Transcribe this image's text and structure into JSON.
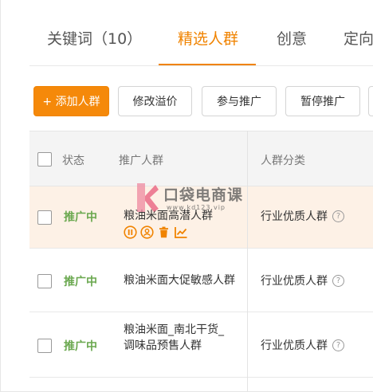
{
  "tabs": [
    {
      "label": "关键词（10）",
      "active": false
    },
    {
      "label": "精选人群",
      "active": true
    },
    {
      "label": "创意",
      "active": false
    },
    {
      "label": "定向",
      "active": false
    }
  ],
  "toolbar": {
    "add_label": "+ 添加人群",
    "modify_label": "修改溢价",
    "join_label": "参与推广",
    "pause_label": "暂停推广"
  },
  "table": {
    "headers": {
      "status": "状态",
      "crowd": "推广人群",
      "category": "人群分类"
    },
    "rows": [
      {
        "status": "推广中",
        "name_line1": "粮油米面高潜人群",
        "name_line2": "",
        "category": "行业优质人群"
      },
      {
        "status": "推广中",
        "name_line1": "粮油米面大促敏感人群",
        "name_line2": "",
        "category": "行业优质人群"
      },
      {
        "status": "推广中",
        "name_line1": "粮油米面_南北干货_",
        "name_line2": "调味品预售人群",
        "category": "行业优质人群"
      }
    ]
  },
  "watermark": {
    "title": "口袋电商课",
    "url": "www.kd123.vip"
  },
  "colors": {
    "accent": "#f08300",
    "status_green": "#6aa84f",
    "highlight_row": "#fdf1e6"
  }
}
